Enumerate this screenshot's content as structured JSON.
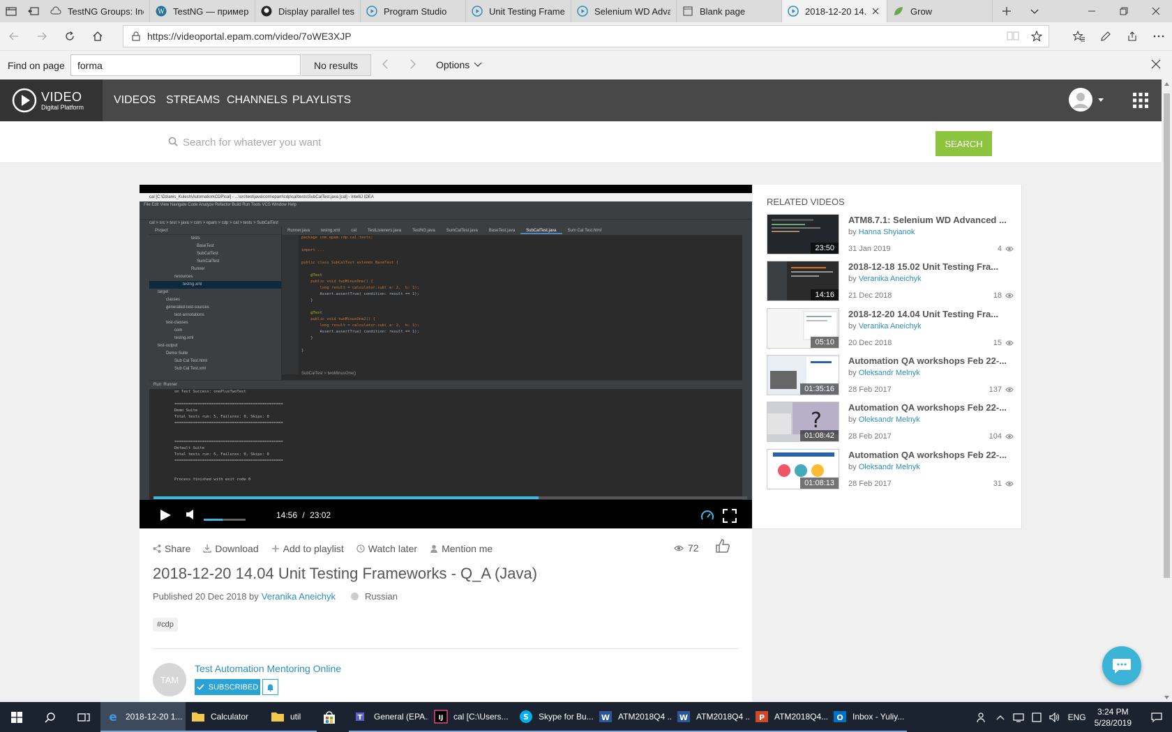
{
  "browser": {
    "tabs": [
      {
        "title": "TestNG Groups: Inc",
        "icon": "cloud-icon"
      },
      {
        "title": "TestNG — пример",
        "icon": "wordpress-icon"
      },
      {
        "title": "Display parallel tes",
        "icon": "github-icon"
      },
      {
        "title": "Program Studio",
        "icon": "play-circle-icon"
      },
      {
        "title": "Unit Testing Frame",
        "icon": "play-circle-icon"
      },
      {
        "title": "Selenium WD Adva",
        "icon": "play-circle-icon"
      },
      {
        "title": "Blank page",
        "icon": "blank-page-icon"
      },
      {
        "title": "2018-12-20 14.",
        "icon": "play-circle-icon",
        "active": true
      },
      {
        "title": "Grow",
        "icon": "leaf-icon"
      }
    ],
    "url": "https://videoportal.epam.com/video/7oWE3XJP",
    "find": {
      "label": "Find on page",
      "value": "forma",
      "results": "No results",
      "options_label": "Options"
    }
  },
  "site": {
    "logo_main": "VIDEO",
    "logo_sub": "Digital Platform",
    "nav": [
      "VIDEOS",
      "STREAMS",
      "CHANNELS",
      "PLAYLISTS"
    ],
    "search_placeholder": "Search for whatever you want",
    "search_button": "SEARCH"
  },
  "player": {
    "current_time": "14:56",
    "separator": "/",
    "duration": "23:02",
    "progress_fraction": 0.649,
    "volume_fraction": 0.45,
    "ide": {
      "title": "cal [C:\\Dzianis_Kulesh\\Automation\\CDP\\cal] - ...\\src\\test\\java\\com\\epam\\cdp\\cal\\tests\\SubCalTest.java [cal] - IntelliJ IDEA",
      "menu": "File   Edit   View   Navigate   Code   Analyze   Refactor   Build   Run   Tools   VCS   Window   Help",
      "breadcrumb": "cal  >  src  >  test  >  java  >  com  >  epam  >  cdp  >  cal  >  tests  >  SubCalTest",
      "project_label": "Project",
      "tree": [
        "tests",
        "BaseTest",
        "SubCalTest",
        "SumCalTest",
        "Runner",
        "resources",
        "testng.xml",
        "target",
        "classes",
        "generated-test-sources",
        "test-annotations",
        "test-classes",
        "com",
        "testng.xml",
        "test-output",
        "Demo Suite",
        "Sub Cal Test.html",
        "Sub Cal Test.xml"
      ],
      "editor_tabs": [
        "Runner.java",
        "testng.xml",
        "cal",
        "TestListeners.java",
        "TestNG.java",
        "SumCalTest.java",
        "BaseTest.java",
        "SubCalTest.java",
        "Sum Cal Test.html"
      ],
      "code": [
        "package com.epam.cdp.cal.tests;",
        "",
        "import ...",
        "",
        "public class SubCalTest extends BaseTest {",
        "",
        "    @Test",
        "    public void twoMinusOne() {",
        "        long result = calculator.sub( a: 2,  b: 1);",
        "        Assert.assertTrue( condition: result == 1);",
        "    }",
        "",
        "    @Test",
        "    public void twoMinusOne2() {",
        "        long result = calculator.sub( a: 2,  b: 1);",
        "        Assert.assertTrue( condition: result == 1);",
        "    }",
        "",
        "}"
      ],
      "editor_footer": "SubCalTest   >   twoMinusOne()",
      "run_label": "Run:   Runner",
      "run_output": [
        "on Test Success: onePlusTwoTest",
        "",
        "===============================================",
        "Demo Suite",
        "Total tests run: 5, Failures: 0, Skips: 0",
        "===============================================",
        "",
        "",
        "===============================================",
        "Default Suite",
        "Total tests run: 5, Failures: 0, Skips: 0",
        "===============================================",
        "",
        "",
        "Process finished with exit code 0"
      ]
    }
  },
  "video": {
    "actions": [
      {
        "label": "Share",
        "icon": "share-icon"
      },
      {
        "label": "Download",
        "icon": "download-icon"
      },
      {
        "label": "Add to playlist",
        "icon": "plus-icon"
      },
      {
        "label": "Watch later",
        "icon": "clock-icon"
      },
      {
        "label": "Mention me",
        "icon": "user-icon"
      }
    ],
    "views": "72",
    "title": "2018-12-20 14.04 Unit Testing Frameworks - Q_A (Java)",
    "published_prefix": "Published 20 Dec 2018 by",
    "author": "Veranika Aneichyk",
    "language": "Russian",
    "tag": "#cdp",
    "channel": {
      "initials": "TAM",
      "name": "Test Automation Mentoring Online",
      "subscribed_label": "SUBSCRIBED"
    }
  },
  "related": {
    "heading": "RELATED VIDEOS",
    "by_prefix": "by",
    "items": [
      {
        "title": "ATM8.7.1: Selenium WD Advanced ...",
        "author": "Hanna Shyianok",
        "date": "31 Jan 2019",
        "views": "4",
        "duration": "23:50"
      },
      {
        "title": "2018-12-18 15.02 Unit Testing Fra...",
        "author": "Veranika Aneichyk",
        "date": "21 Dec 2018",
        "views": "18",
        "duration": "14:16"
      },
      {
        "title": "2018-12-20 14.04 Unit Testing Fra...",
        "author": "Veranika Aneichyk",
        "date": "20 Dec 2018",
        "views": "15",
        "duration": "05:10"
      },
      {
        "title": "Automation QA workshops Feb 22-...",
        "author": "Oleksandr Melnyk",
        "date": "28 Feb 2017",
        "views": "137",
        "duration": "01:35:16"
      },
      {
        "title": "Automation QA workshops Feb 22-...",
        "author": "Oleksandr Melnyk",
        "date": "28 Feb 2017",
        "views": "104",
        "duration": "01:08:42"
      },
      {
        "title": "Automation QA workshops Feb 22-...",
        "author": "Oleksandr Melnyk",
        "date": "28 Feb 2017",
        "views": "31",
        "duration": "01:08:13"
      }
    ]
  },
  "taskbar": {
    "apps": [
      {
        "label": "2018-12-20 1...",
        "icon": "edge-icon",
        "active": true
      },
      {
        "label": "Calculator",
        "icon": "folder-icon"
      },
      {
        "label": "util",
        "icon": "folder-icon"
      },
      {
        "label": "",
        "icon": "store-icon"
      },
      {
        "label": "General (EPA...",
        "icon": "teams-icon"
      },
      {
        "label": "cal [C:\\Users...",
        "icon": "intellij-icon"
      },
      {
        "label": "Skype for Bu...",
        "icon": "skype-icon"
      },
      {
        "label": "ATM2018Q4 ...",
        "icon": "word-icon"
      },
      {
        "label": "ATM2018Q4 ...",
        "icon": "word-icon"
      },
      {
        "label": "ATM2018Q4...",
        "icon": "powerpoint-icon"
      },
      {
        "label": "Inbox - Yuliy...",
        "icon": "outlook-icon"
      }
    ],
    "language": "ENG",
    "time": "3:24 PM",
    "date": "5/28/2019"
  },
  "colors": {
    "accent_blue": "#2a8fbd",
    "search_green": "#8cc43f",
    "header_dark": "#484848",
    "progress_blue": "#40b6e0",
    "chat_blue": "#3bb4d8"
  }
}
